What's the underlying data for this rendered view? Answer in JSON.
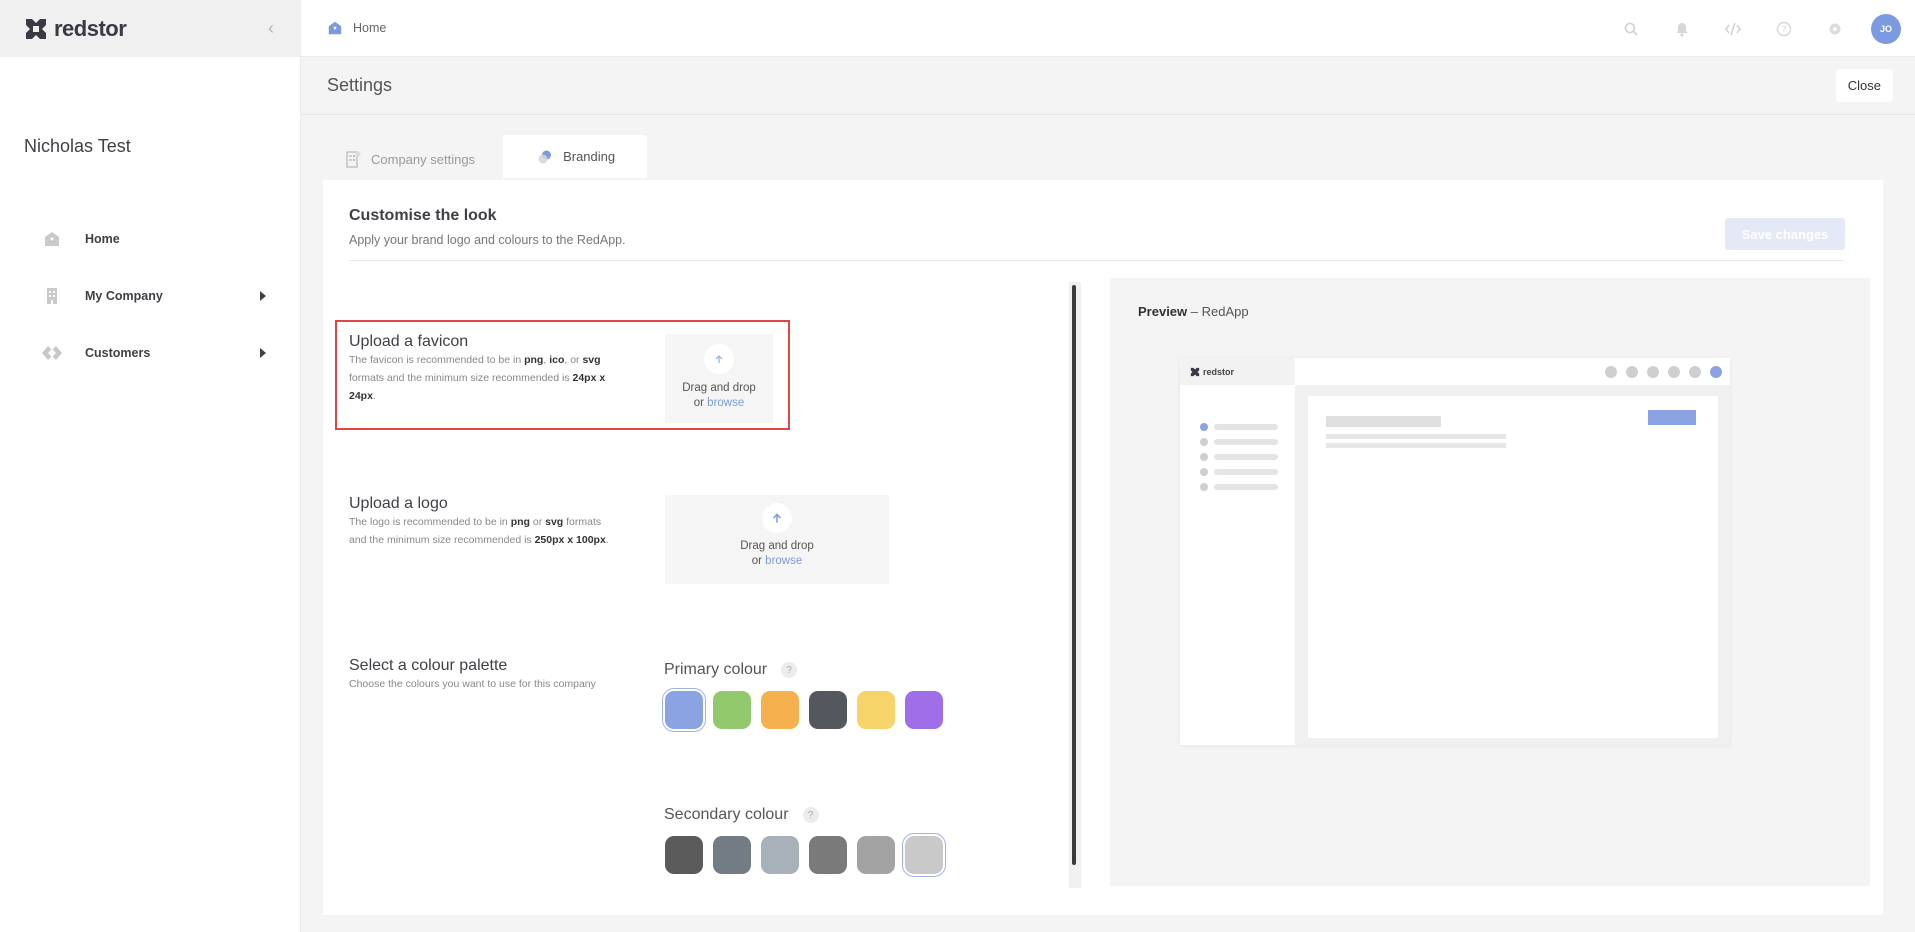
{
  "brand": {
    "name": "redstor"
  },
  "sidebar": {
    "company": "Nicholas Test",
    "items": [
      {
        "label": "Home",
        "icon": "home-icon",
        "has_submenu": false
      },
      {
        "label": "My Company",
        "icon": "building-icon",
        "has_submenu": true
      },
      {
        "label": "Customers",
        "icon": "customers-icon",
        "has_submenu": true
      }
    ]
  },
  "topbar": {
    "breadcrumb": "Home",
    "icons": [
      "search-icon",
      "bell-icon",
      "code-icon",
      "help-icon",
      "gear-icon"
    ],
    "avatar_initials": "JO"
  },
  "page": {
    "title": "Settings",
    "close_label": "Close"
  },
  "tabs": [
    {
      "label": "Company settings",
      "active": false
    },
    {
      "label": "Branding",
      "active": true
    }
  ],
  "branding": {
    "title": "Customise the look",
    "subtitle": "Apply your brand logo and colours to the RedApp.",
    "save_label": "Save changes",
    "favicon": {
      "title": "Upload a favicon",
      "desc_pre": "The favicon is recommended to be in ",
      "fmt1": "png",
      "sep1": ", ",
      "fmt2": "ico",
      "sep2": ", or ",
      "fmt3": "svg",
      "desc_mid": " formats and the minimum size recommended is ",
      "size": "24px x 24px",
      "desc_end": ".",
      "drop_text": "Drag and drop",
      "or": "or ",
      "browse": "browse"
    },
    "logo": {
      "title": "Upload a logo",
      "desc_pre": "The logo is recommended to be in ",
      "fmt1": "png",
      "sep1": " or ",
      "fmt2": "svg",
      "desc_mid": " formats and the minimum size recommended is ",
      "size": "250px x 100px",
      "desc_end": ".",
      "drop_text": "Drag and drop",
      "or": "or ",
      "browse": "browse"
    },
    "palette": {
      "title": "Select a colour palette",
      "desc": "Choose the colours you want to use for this company",
      "primary_label": "Primary colour",
      "secondary_label": "Secondary colour",
      "help": "?",
      "primary_colors": [
        "#8aa3e3",
        "#92c96d",
        "#f5b14e",
        "#55575f",
        "#f6d46a",
        "#a06ee8"
      ],
      "primary_selected": 0,
      "secondary_colors": [
        "#5b5b5b",
        "#737b84",
        "#a8b0ba",
        "#7a7a7a",
        "#a3a3a3",
        "#c9c9c9"
      ],
      "secondary_selected": 5
    },
    "preview": {
      "label": "Preview",
      "sep": " – ",
      "app": "RedApp",
      "mock_brand": "redstor"
    }
  }
}
